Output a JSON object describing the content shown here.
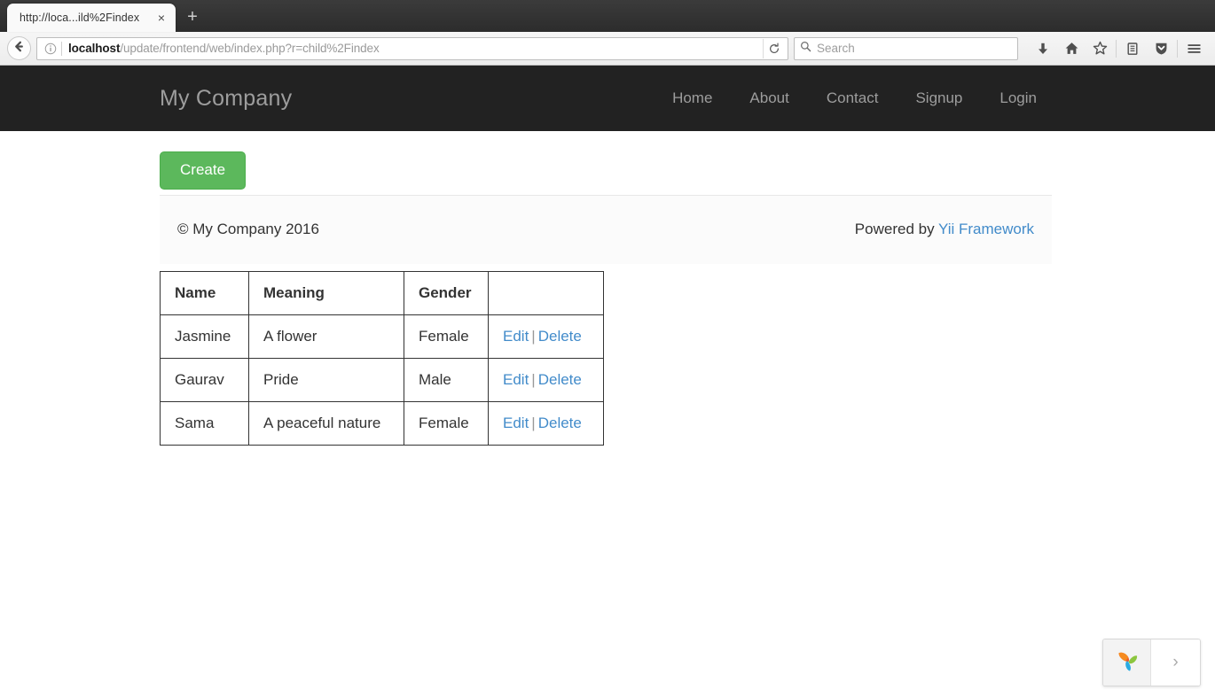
{
  "browser": {
    "tab": {
      "title": "http://loca...ild%2Findex",
      "close_label": "×",
      "newtab_label": "+"
    },
    "toolbar": {
      "back_icon": "back-arrow-icon",
      "identity_icon": "info-circle-icon",
      "url_host": "localhost",
      "url_path": "/update/frontend/web/index.php?r=child%2Findex",
      "url_full": "localhost/update/frontend/web/index.php?r=child%2Findex",
      "reload_icon": "reload-icon",
      "search_placeholder": "Search",
      "search_value": "",
      "icons": [
        {
          "name": "downloads-icon"
        },
        {
          "name": "home-icon"
        },
        {
          "name": "bookmark-star-icon"
        },
        {
          "name": "library-icon"
        },
        {
          "name": "pocket-shield-icon"
        },
        {
          "name": "hamburger-menu-icon"
        }
      ]
    }
  },
  "site": {
    "brand": "My Company",
    "nav_links": [
      {
        "label": "Home"
      },
      {
        "label": "About"
      },
      {
        "label": "Contact"
      },
      {
        "label": "Signup"
      },
      {
        "label": "Login"
      }
    ],
    "create_button": "Create",
    "footer": {
      "copyright": "© My Company 2016",
      "powered_prefix": "Powered by ",
      "powered_link": "Yii Framework"
    },
    "table": {
      "headers": [
        "Name",
        "Meaning",
        "Gender",
        ""
      ],
      "rows": [
        {
          "name": "Jasmine",
          "meaning": "A flower",
          "gender": "Female",
          "edit": "Edit",
          "separator": "|",
          "delete": "Delete"
        },
        {
          "name": "Gaurav",
          "meaning": "Pride",
          "gender": "Male",
          "edit": "Edit",
          "separator": "|",
          "delete": "Delete"
        },
        {
          "name": "Sama",
          "meaning": "A peaceful nature",
          "gender": "Female",
          "edit": "Edit",
          "separator": "|",
          "delete": "Delete"
        }
      ]
    },
    "debug_toolbar": {
      "logo_name": "yii-logo-icon",
      "toggle_label": "›"
    }
  },
  "colors": {
    "navbar_bg": "#222222",
    "navbar_text": "#9d9d9d",
    "create_green": "#5cb85c",
    "link_blue": "#428bca",
    "table_border": "#333333"
  }
}
